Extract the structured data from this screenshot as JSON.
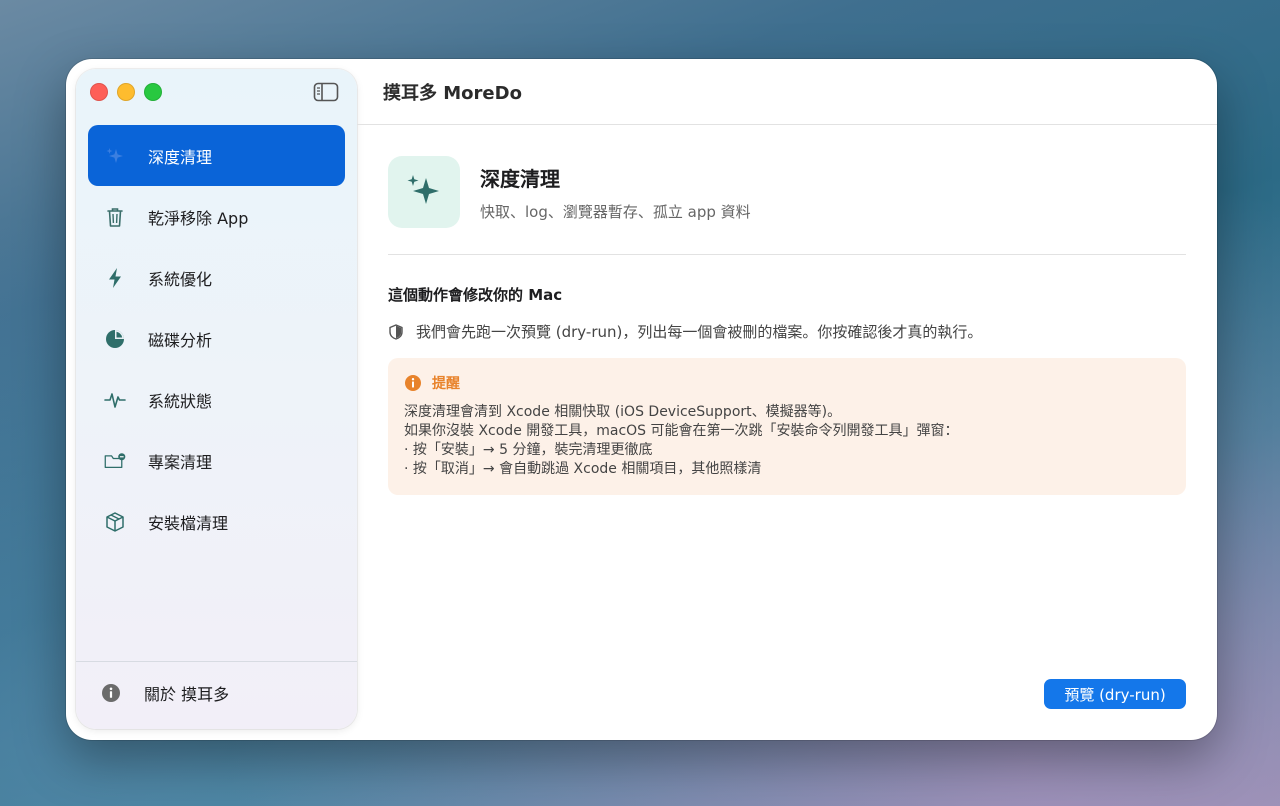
{
  "window": {
    "title": "摸耳多 MoreDo"
  },
  "sidebar": {
    "items": [
      {
        "label": "深度清理",
        "icon": "sparkle-icon",
        "active": true
      },
      {
        "label": "乾淨移除 App",
        "icon": "trash-icon",
        "active": false
      },
      {
        "label": "系統優化",
        "icon": "bolt-icon",
        "active": false
      },
      {
        "label": "磁碟分析",
        "icon": "pie-chart-icon",
        "active": false
      },
      {
        "label": "系統狀態",
        "icon": "waveform-icon",
        "active": false
      },
      {
        "label": "專案清理",
        "icon": "folder-minus-icon",
        "active": false
      },
      {
        "label": "安裝檔清理",
        "icon": "cube-icon",
        "active": false
      }
    ],
    "about_label": "關於 摸耳多"
  },
  "hero": {
    "title": "深度清理",
    "subtitle": "快取、log、瀏覽器暫存、孤立 app 資料"
  },
  "warning": {
    "title": "這個動作會修改你的 Mac",
    "line": "我們會先跑一次預覽 (dry-run)，列出每一個會被刪的檔案。你按確認後才真的執行。"
  },
  "notice": {
    "title": "提醒",
    "lines": [
      "深度清理會清到 Xcode 相關快取 (iOS DeviceSupport、模擬器等)。",
      "如果你沒裝 Xcode 開發工具，macOS 可能會在第一次跳「安裝命令列開發工具」彈窗：",
      "· 按「安裝」→ 5 分鐘，裝完清理更徹底",
      "· 按「取消」→ 會自動跳過 Xcode 相關項目，其他照樣清"
    ]
  },
  "actions": {
    "preview_label": "預覽 (dry-run)"
  },
  "colors": {
    "accent": "#0a64d8",
    "button": "#1477ea",
    "notice_bg": "#fdf1e8",
    "notice_accent": "#e8832b",
    "hero_icon_bg": "#e1f4ee",
    "hero_icon_fg": "#2f6e6a"
  }
}
